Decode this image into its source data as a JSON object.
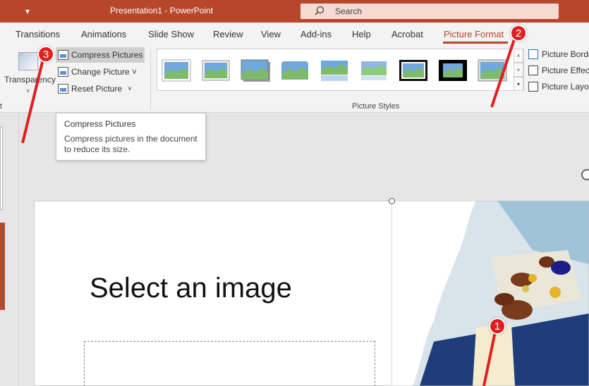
{
  "titlebar": {
    "qat_glyph": "▾",
    "doc_title": "Presentation1  -  PowerPoint",
    "search_placeholder": "Search"
  },
  "tabs": [
    {
      "label": "Transitions",
      "active": false
    },
    {
      "label": "Animations",
      "active": false
    },
    {
      "label": "Slide Show",
      "active": false
    },
    {
      "label": "Review",
      "active": false
    },
    {
      "label": "View",
      "active": false
    },
    {
      "label": "Add-ins",
      "active": false
    },
    {
      "label": "Help",
      "active": false
    },
    {
      "label": "Acrobat",
      "active": false
    },
    {
      "label": "Picture Format",
      "active": true
    }
  ],
  "ribbon": {
    "transparency_label": "Transparency",
    "compress_label": "Compress Pictures",
    "change_label": "Change Picture ˅",
    "reset_label": "Reset Picture",
    "reset_dropdown": "˅",
    "picture_styles_label": "Picture Styles",
    "left_group_label": "t",
    "picture_border": "Picture Borde",
    "picture_effects": "Picture Effect",
    "picture_layout": "Picture Layou"
  },
  "tooltip": {
    "title": "Compress Pictures",
    "body": "Compress pictures in the document to reduce its size."
  },
  "slide": {
    "title": "Select an image"
  },
  "annotations": [
    {
      "number": "1"
    },
    {
      "number": "2"
    },
    {
      "number": "3"
    }
  ],
  "colors": {
    "accent": "#b7472a",
    "annotation_red": "#e02020"
  }
}
